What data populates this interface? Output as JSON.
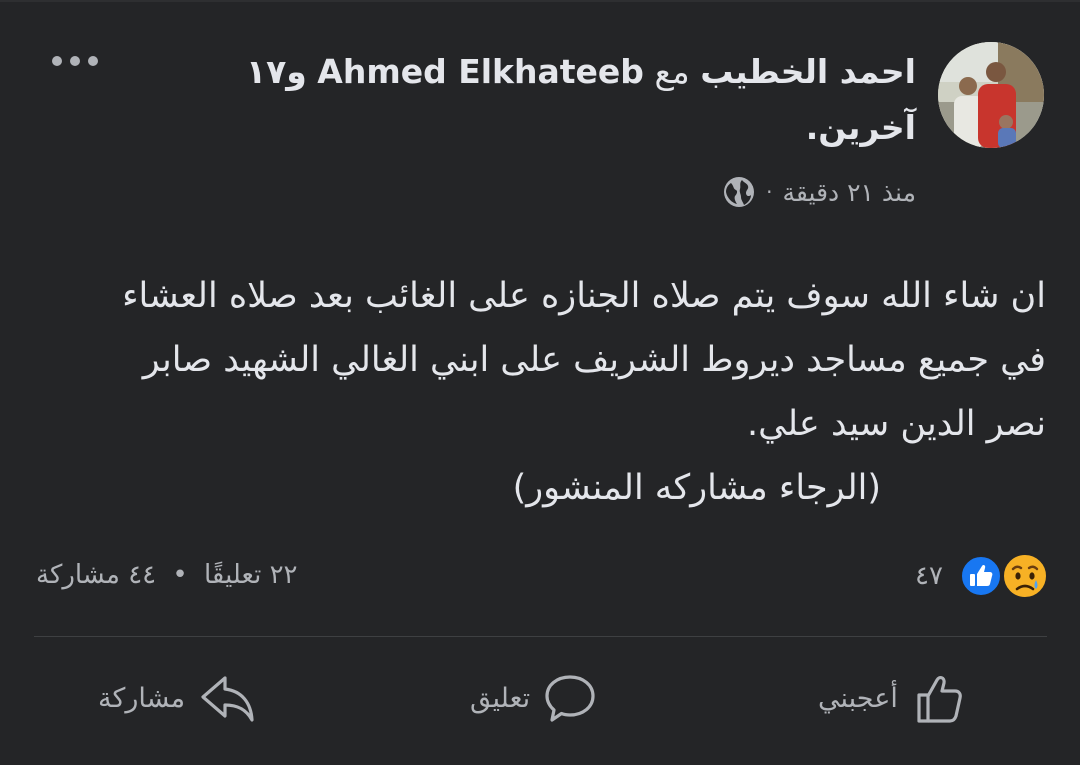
{
  "post": {
    "author_name": "احمد الخطيب",
    "with_word": "مع",
    "tagged_name": "Ahmed Elkhateeb",
    "others_text": "و١٧ آخرين.",
    "timestamp": "منذ ٢١ دقيقة",
    "privacy_icon": "globe-icon",
    "text_lines": [
      "ان شاء الله سوف يتم صلاه الجنازه على الغائب بعد صلاه العشاء",
      "في جميع مساجد ديروط الشريف على ابني الغالي الشهيد صابر",
      "نصر الدين سيد علي.",
      "(الرجاء مشاركه المنشور)"
    ]
  },
  "reactions": {
    "icons": [
      "sad-icon",
      "like-icon"
    ],
    "count": "٤٧"
  },
  "stats": {
    "comments": "٢٢ تعليقًا",
    "separator": "•",
    "shares": "٤٤ مشاركة"
  },
  "actions": {
    "like": "أعجبني",
    "comment": "تعليق",
    "share": "مشاركة"
  },
  "colors": {
    "background": "#242527",
    "text_primary": "#e4e6eb",
    "text_secondary": "#b0b3b8",
    "like_blue": "#1877f2",
    "sad_yellow": "#f7b125"
  }
}
